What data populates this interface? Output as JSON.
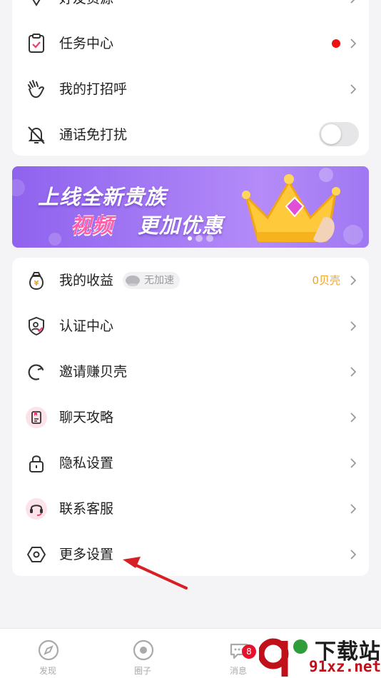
{
  "top_menu": {
    "partial_item": "好友资源",
    "items": [
      {
        "label": "任务中心",
        "icon": "clipboard-check-icon",
        "has_red_dot": true
      },
      {
        "label": "我的打招呼",
        "icon": "wave-hand-icon"
      },
      {
        "label": "通话免打扰",
        "icon": "bell-mute-icon",
        "toggle_on": false
      }
    ]
  },
  "banner": {
    "line1": "上线全新贵族",
    "line2_highlight": "视频",
    "line2_rest": "更加优惠",
    "page_count": 3,
    "active_index": 0
  },
  "menu": {
    "items": [
      {
        "label": "我的收益",
        "icon": "money-bag-icon",
        "chip": "无加速",
        "value": "0贝壳"
      },
      {
        "label": "认证中心",
        "icon": "shield-verify-icon"
      },
      {
        "label": "邀请赚贝壳",
        "icon": "refresh-arrow-icon"
      },
      {
        "label": "聊天攻略",
        "icon": "guide-book-icon"
      },
      {
        "label": "隐私设置",
        "icon": "lock-icon"
      },
      {
        "label": "联系客服",
        "icon": "headset-icon"
      },
      {
        "label": "更多设置",
        "icon": "hexagon-settings-icon"
      }
    ]
  },
  "tabbar": {
    "tabs": [
      {
        "label": "发现",
        "icon": "compass-icon"
      },
      {
        "label": "圈子",
        "icon": "circle-dot-icon"
      },
      {
        "label": "消息",
        "icon": "chat-bubble-icon",
        "badge": "8"
      }
    ]
  },
  "watermark": {
    "title": "下载站",
    "url": "91xz.net"
  },
  "colors": {
    "accent_gold": "#f0a12a",
    "red_dot": "#ee1111",
    "banner_purple": "#9f78f2",
    "badge_red": "#e8112d",
    "arrow_red": "#d71f26"
  }
}
